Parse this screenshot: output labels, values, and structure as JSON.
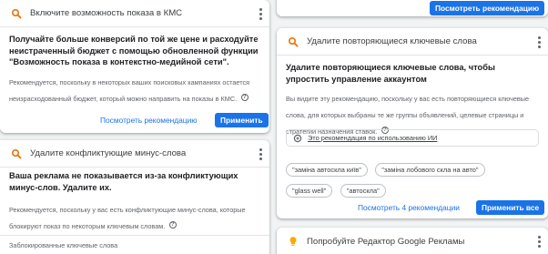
{
  "card_cms": {
    "title": "Включите возможность показа в КМС",
    "headline": "Получайте больше конверсий по той же цене и расходуйте неистраченный бюджет с помощью обновленной функции \"Возможность показа в контекстно-медийной сети\".",
    "note": "Рекомендуется, поскольку в некоторых ваших поисковых кампаниях остается неизрасходованный бюджет, который можно направить на показы в КМС.",
    "view_label": "Посмотреть рекомендацию",
    "apply_label": "Применить"
  },
  "card_top_right": {
    "view_label": "Посмотреть рекомендацию"
  },
  "card_duplicates": {
    "title": "Удалите повторяющиеся ключевые слова",
    "headline": "Удалите повторяющиеся ключевые слова, чтобы упростить управление аккаунтом",
    "note": "Вы видите эту рекомендацию, поскольку у вас есть повторяющиеся ключевые слова, для которых выбраны те же группы объявлений, целевые страницы и стратегии назначения ставок.",
    "ai_note": "Это рекомендация по использованию ИИ",
    "chips": [
      "\"заміна автоскла київ\"",
      "\"заміна лобового скла на авто\"",
      "\"glass well\"",
      "\"автоскла\""
    ],
    "view_label": "Посмотреть 4 рекомендации",
    "apply_label": "Применить все"
  },
  "card_negatives": {
    "title": "Удалите конфликтующие минус-слова",
    "headline": "Ваша реклама не показывается из-за конфликтующих минус-слов. Удалите их.",
    "note": "Рекомендуется, поскольку у вас есть конфликтующие минус-слова, которые блокируют показ по некоторым ключевым словам.",
    "section_label": "Заблокированные ключевые слова"
  },
  "card_editor": {
    "title": "Попробуйте Редактор Google Рекламы"
  },
  "colors": {
    "accent": "#1a73e8",
    "icon_orange": "#e8710a",
    "bulb": "#f9ab00"
  },
  "icons": [
    "search-icon",
    "help-icon",
    "more-vert-icon",
    "ai-sparkle-icon",
    "lightbulb-icon"
  ]
}
